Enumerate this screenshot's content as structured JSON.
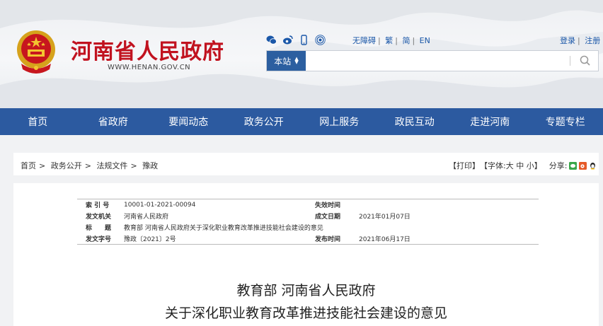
{
  "header": {
    "site_title": "河南省人民政府",
    "site_url": "WWW.HENAN.GOV.CN",
    "social_icons": [
      "wechat-icon",
      "weibo-icon",
      "mobile-icon",
      "broadcast-icon"
    ],
    "lang_links": [
      "无障碍",
      "繁",
      "简",
      "EN"
    ],
    "auth_links": [
      "登录",
      "注册"
    ]
  },
  "search": {
    "scope": "本站",
    "placeholder": ""
  },
  "nav": {
    "items": [
      "首页",
      "省政府",
      "要闻动态",
      "政务公开",
      "网上服务",
      "政民互动",
      "走进河南",
      "专题专栏"
    ]
  },
  "breadcrumb": {
    "items": [
      "首页",
      "政务公开",
      "法规文件",
      "豫政"
    ]
  },
  "tools": {
    "print": "【打印】",
    "font_prefix": "【字体: ",
    "font_large": "大",
    "font_medium": "中",
    "font_small": "小",
    "font_suffix": "】",
    "share_label": "分享:"
  },
  "meta": {
    "index_label": "索 引 号",
    "index_value": "10001-01-2021-00094",
    "expire_label": "失效时间",
    "expire_value": "",
    "issuer_label": "发文机关",
    "issuer_value": "河南省人民政府",
    "created_label": "成文日期",
    "created_value": "2021年01月07日",
    "title_label": "标　　题",
    "title_value": "教育部 河南省人民政府关于深化职业教育改革推进技能社会建设的意见",
    "docno_label": "发文字号",
    "docno_value": "豫政〔2021〕2号",
    "published_label": "发布时间",
    "published_value": "2021年06月17日"
  },
  "document": {
    "title_line1": "教育部  河南省人民政府",
    "title_line2": "关于深化职业教育改革推进技能社会建设的意见"
  },
  "colors": {
    "brand_red": "#c1121f",
    "nav_blue": "#2c5aa0",
    "link_blue": "#1a57a8"
  }
}
